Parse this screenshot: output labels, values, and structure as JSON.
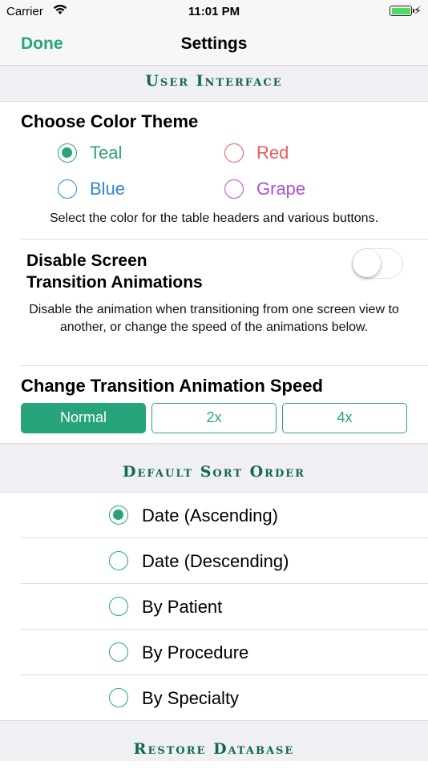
{
  "status_bar": {
    "carrier": "Carrier",
    "time": "11:01 PM"
  },
  "nav": {
    "done_label": "Done",
    "title": "Settings"
  },
  "sections": {
    "user_interface": "User Interface",
    "default_sort_order": "Default Sort Order",
    "restore_database": "Restore Database"
  },
  "color_theme": {
    "heading": "Choose Color Theme",
    "options": [
      {
        "label": "Teal",
        "color": "#27a47c",
        "selected": true
      },
      {
        "label": "Red",
        "color": "#ee5a5a",
        "selected": false
      },
      {
        "label": "Blue",
        "color": "#2f86d6",
        "selected": false
      },
      {
        "label": "Grape",
        "color": "#b14fd0",
        "selected": false
      }
    ],
    "description": "Select the color for the table headers and various buttons."
  },
  "animations": {
    "toggle_label": "Disable Screen Transition Animations",
    "toggle_label_line1": "Disable Screen",
    "toggle_label_line2": "Transition Animations",
    "toggle_on": false,
    "description": "Disable the animation when transitioning from one screen view to another, or change the speed of the animations below."
  },
  "speed": {
    "heading": "Change Transition Animation Speed",
    "options": [
      "Normal",
      "2x",
      "4x"
    ],
    "selected": "Normal"
  },
  "sort_order": {
    "options": [
      {
        "label": "Date (Ascending)",
        "selected": true
      },
      {
        "label": "Date (Descending)",
        "selected": false
      },
      {
        "label": "By Patient",
        "selected": false
      },
      {
        "label": "By Procedure",
        "selected": false
      },
      {
        "label": "By Specialty",
        "selected": false
      }
    ]
  },
  "accent_color": "#27a47c",
  "header_text_color": "#12684c"
}
